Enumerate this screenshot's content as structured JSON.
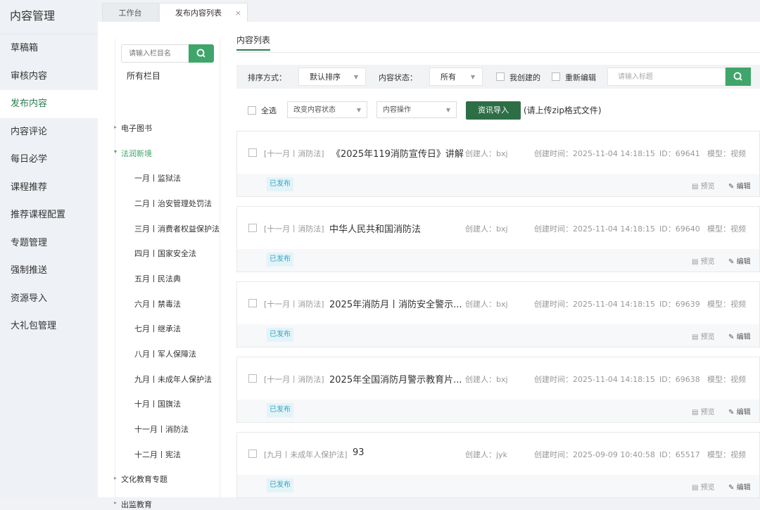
{
  "sidebar": {
    "title": "内容管理",
    "items": [
      {
        "label": "草稿箱"
      },
      {
        "label": "审核内容"
      },
      {
        "label": "发布内容"
      },
      {
        "label": "内容评论"
      },
      {
        "label": "每日必学"
      },
      {
        "label": "课程推荐"
      },
      {
        "label": "推荐课程配置"
      },
      {
        "label": "专题管理"
      },
      {
        "label": "强制推送"
      },
      {
        "label": "资源导入"
      },
      {
        "label": "大礼包管理"
      }
    ],
    "active_index": 2
  },
  "tabs": [
    {
      "label": "工作台"
    },
    {
      "label": "发布内容列表",
      "close": "×"
    }
  ],
  "tree": {
    "search_placeholder": "请输入栏目名",
    "root": "所有栏目",
    "groups": [
      {
        "label": "电子图书"
      },
      {
        "label": "法润新境"
      },
      {
        "label": "文化教育专题"
      },
      {
        "label": "出监教育"
      }
    ],
    "children": [
      {
        "label": "一月丨监狱法"
      },
      {
        "label": "二月丨治安管理处罚法"
      },
      {
        "label": "三月丨消费者权益保护法"
      },
      {
        "label": "四月丨国家安全法"
      },
      {
        "label": "五月丨民法典"
      },
      {
        "label": "六月丨禁毒法"
      },
      {
        "label": "七月丨继承法"
      },
      {
        "label": "八月丨军人保障法"
      },
      {
        "label": "九月丨未成年人保护法"
      },
      {
        "label": "十月丨国旗法"
      },
      {
        "label": "十一月丨消防法"
      },
      {
        "label": "十二月丨宪法"
      }
    ]
  },
  "content": {
    "title": "内容列表",
    "filter": {
      "sort_label": "排序方式：",
      "sort_value": "默认排序",
      "status_label": "内容状态：",
      "status_value": "所有",
      "mine_label": "我创建的",
      "reedit_label": "重新编辑",
      "search_placeholder": "请输入标题"
    },
    "actions": {
      "select_all": "全选",
      "change_status": "改变内容状态",
      "content_op": "内容操作",
      "import_button": "资讯导入",
      "hint": "(请上传zip格式文件)"
    },
    "items": [
      {
        "category": "[十一月丨消防法]",
        "title": "《2025年119消防宣传日》讲解",
        "creator": "创建人：bxj",
        "created": "创建时间：2025-11-04 14:18:15",
        "id": "ID：69641",
        "model": "模型：视频",
        "status": "已发布"
      },
      {
        "category": "[十一月丨消防法]",
        "title": "中华人民共和国消防法",
        "creator": "创建人：bxj",
        "created": "创建时间：2025-11-04 14:18:15",
        "id": "ID：69640",
        "model": "模型：视频",
        "status": "已发布"
      },
      {
        "category": "[十一月丨消防法]",
        "title": "2025年消防月丨消防安全警示...",
        "creator": "创建人：bxj",
        "created": "创建时间：2025-11-04 14:18:15",
        "id": "ID：69639",
        "model": "模型：视频",
        "status": "已发布"
      },
      {
        "category": "[十一月丨消防法]",
        "title": "2025年全国消防月警示教育片...",
        "creator": "创建人：bxj",
        "created": "创建时间：2025-11-04 14:18:15",
        "id": "ID：69638",
        "model": "模型：视频",
        "status": "已发布"
      },
      {
        "category": "[九月丨未成年人保护法]",
        "title": "93",
        "creator": "创建人：jyk",
        "created": "创建时间：2025-09-09 10:40:58",
        "id": "ID：65517",
        "model": "模型：视频",
        "status": "已发布"
      }
    ],
    "preview_label": "预览",
    "edit_label": "编辑"
  },
  "colors": {
    "accent": "#3fa56b",
    "accent_dark": "#2e6e46",
    "badge_bg": "#e3f4f8",
    "badge_text": "#3aa3c2"
  }
}
